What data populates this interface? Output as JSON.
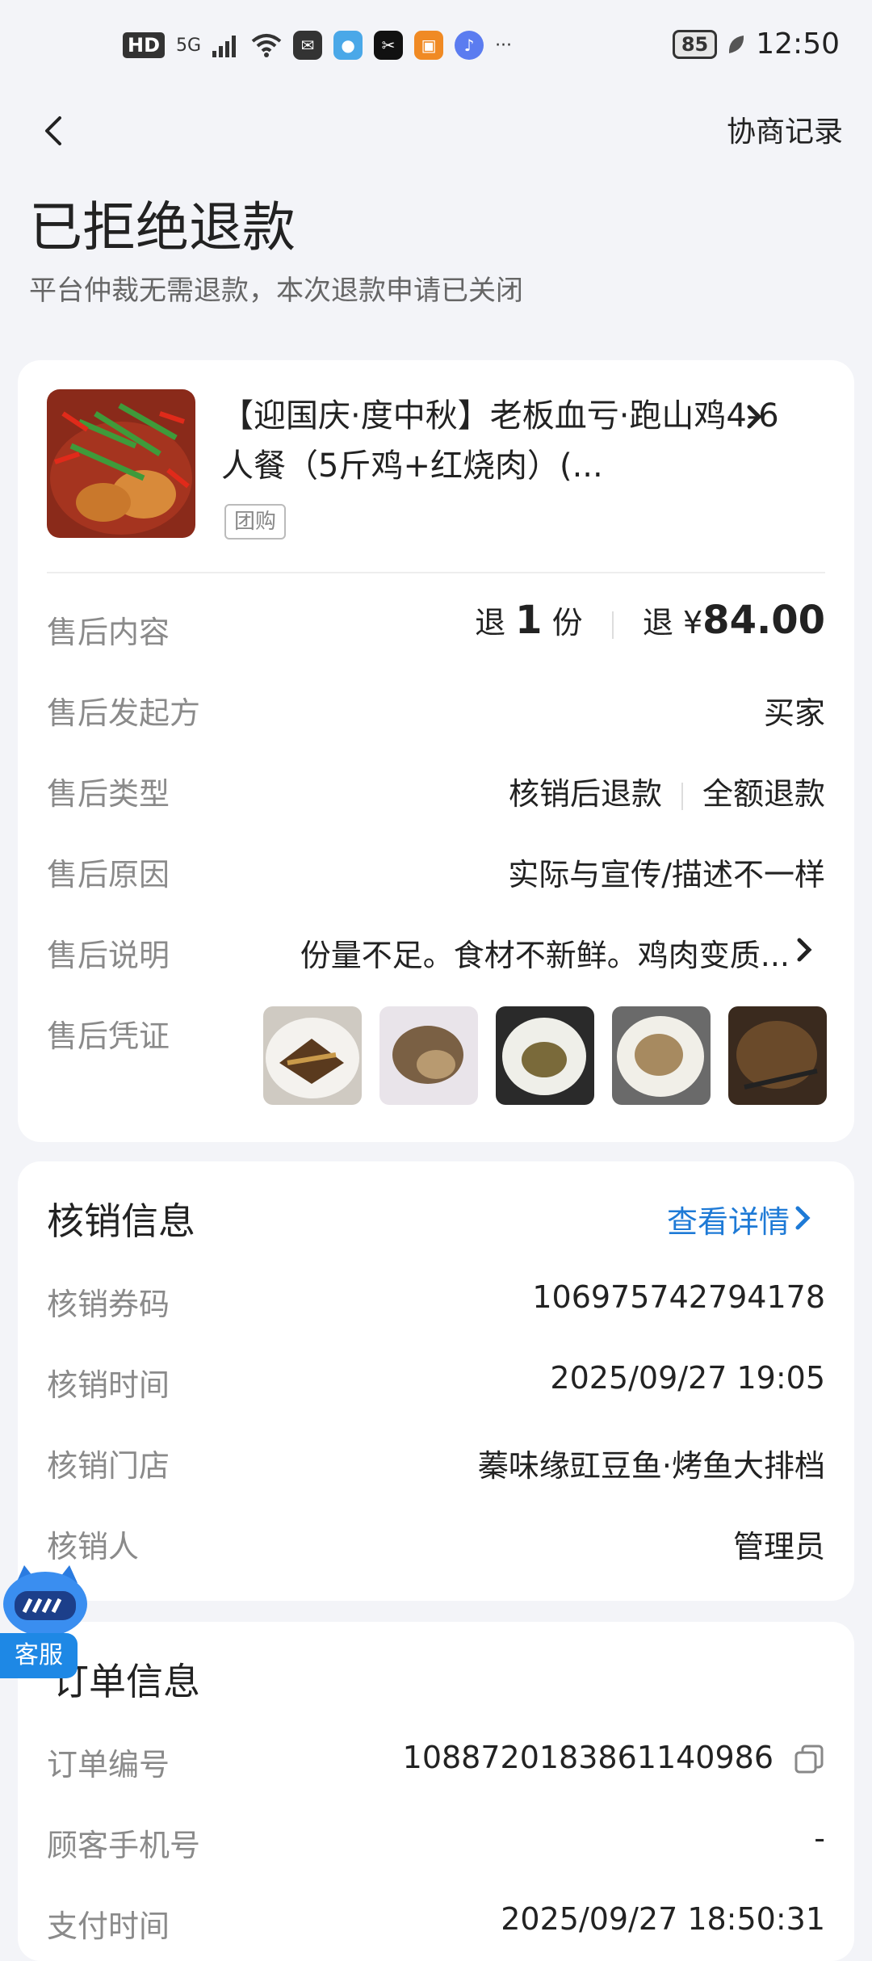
{
  "status_bar": {
    "hd": "HD",
    "signal": "5G",
    "battery": "85",
    "time": "12:50",
    "more": "···"
  },
  "header": {
    "coop_record": "协商记录"
  },
  "page": {
    "title": "已拒绝退款",
    "subtitle": "平台仲裁无需退款，本次退款申请已关闭"
  },
  "product": {
    "name": "【迎国庆·度中秋】老板血亏·跑山鸡4-6人餐（5斤鸡+红烧肉）(...",
    "tag": "团购"
  },
  "after_sale": {
    "rows": [
      {
        "label": "售后内容"
      },
      {
        "label": "售后发起方",
        "value": "买家"
      },
      {
        "label": "售后类型",
        "value_a": "核销后退款",
        "value_b": "全额退款"
      },
      {
        "label": "售后原因",
        "value": "实际与宣传/描述不一样"
      },
      {
        "label": "售后说明",
        "value": "份量不足。食材不新鲜。鸡肉变质..."
      },
      {
        "label": "售后凭证"
      }
    ],
    "content": {
      "refund_word": "退",
      "qty": "1",
      "unit": "份",
      "refund_word2": "退",
      "currency": "¥",
      "amount": "84.00"
    }
  },
  "verify": {
    "title": "核销信息",
    "detail_link": "查看详情",
    "rows": [
      {
        "label": "核销券码",
        "value": "106975742794178"
      },
      {
        "label": "核销时间",
        "value": "2025/09/27 19:05"
      },
      {
        "label": "核销门店",
        "value": "蓁味缘豇豆鱼·烤鱼大排档"
      },
      {
        "label": "核销人",
        "value": "管理员"
      }
    ]
  },
  "order": {
    "title": "订单信息",
    "rows": [
      {
        "label": "订单编号",
        "value": "1088720183861140986"
      },
      {
        "label": "顾客手机号",
        "value": "-"
      },
      {
        "label": "支付时间",
        "value": "2025/09/27 18:50:31"
      }
    ]
  },
  "floating": {
    "cs_label": "客服"
  },
  "colors": {
    "accent": "#1e7ad6",
    "background": "#f3f4f8",
    "label_gray": "#8a8a8a"
  }
}
